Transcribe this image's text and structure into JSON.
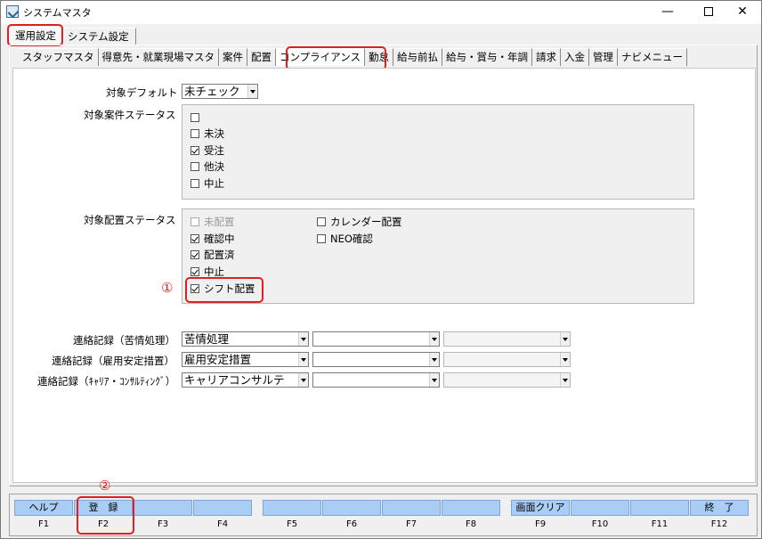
{
  "window": {
    "title": "システムマスタ",
    "min": "—",
    "close": "✕"
  },
  "top_tabs": [
    "運用設定",
    "システム設定"
  ],
  "sub_tabs": [
    "スタッフマスタ",
    "得意先・就業現場マスタ",
    "案件",
    "配置",
    "コンプライアンス",
    "勤怠",
    "給与前払",
    "給与・賞与・年調",
    "請求",
    "入金",
    "管理",
    "ナビメニュー"
  ],
  "form": {
    "default_label": "対象デフォルト",
    "default_value": "未チェック",
    "case_status_label": "対象案件ステータス",
    "case_status": [
      {
        "label": "",
        "checked": false,
        "enabled": true
      },
      {
        "label": "未決",
        "checked": false,
        "enabled": true
      },
      {
        "label": "受注",
        "checked": true,
        "enabled": true
      },
      {
        "label": "他決",
        "checked": false,
        "enabled": true
      },
      {
        "label": "中止",
        "checked": false,
        "enabled": true
      }
    ],
    "assign_status_label": "対象配置ステータス",
    "assign_status": [
      {
        "label": "未配置",
        "checked": false,
        "enabled": false
      },
      {
        "label": "確認中",
        "checked": true,
        "enabled": true
      },
      {
        "label": "配置済",
        "checked": true,
        "enabled": true
      },
      {
        "label": "中止",
        "checked": true,
        "enabled": true
      },
      {
        "label": "シフト配置",
        "checked": true,
        "enabled": true
      },
      {
        "label": "カレンダー配置",
        "checked": false,
        "enabled": true
      },
      {
        "label": "NEO確認",
        "checked": false,
        "enabled": true
      }
    ],
    "contact_rows": [
      {
        "label": "連絡記録（苦情処理）",
        "value": "苦情処理"
      },
      {
        "label": "連絡記録（雇用安定措置）",
        "value": "雇用安定措置"
      },
      {
        "label": "連絡記録（ｷｬﾘｱ・ｺﾝｻﾙﾃｨﾝｸﾞ）",
        "value": "キャリアコンサルテ"
      }
    ]
  },
  "annotations": [
    "①",
    "②"
  ],
  "fkeys": [
    {
      "label": "ヘルプ",
      "key": "F1"
    },
    {
      "label": "登　録",
      "key": "F2"
    },
    {
      "label": "",
      "key": "F3"
    },
    {
      "label": "",
      "key": "F4"
    },
    {
      "label": "",
      "key": "F5"
    },
    {
      "label": "",
      "key": "F6"
    },
    {
      "label": "",
      "key": "F7"
    },
    {
      "label": "",
      "key": "F8"
    },
    {
      "label": "画面クリア",
      "key": "F9"
    },
    {
      "label": "",
      "key": "F10"
    },
    {
      "label": "",
      "key": "F11"
    },
    {
      "label": "終　了",
      "key": "F12"
    }
  ],
  "colors": {
    "highlight": "#e02020",
    "fkey_button": "#a9cdf4"
  }
}
